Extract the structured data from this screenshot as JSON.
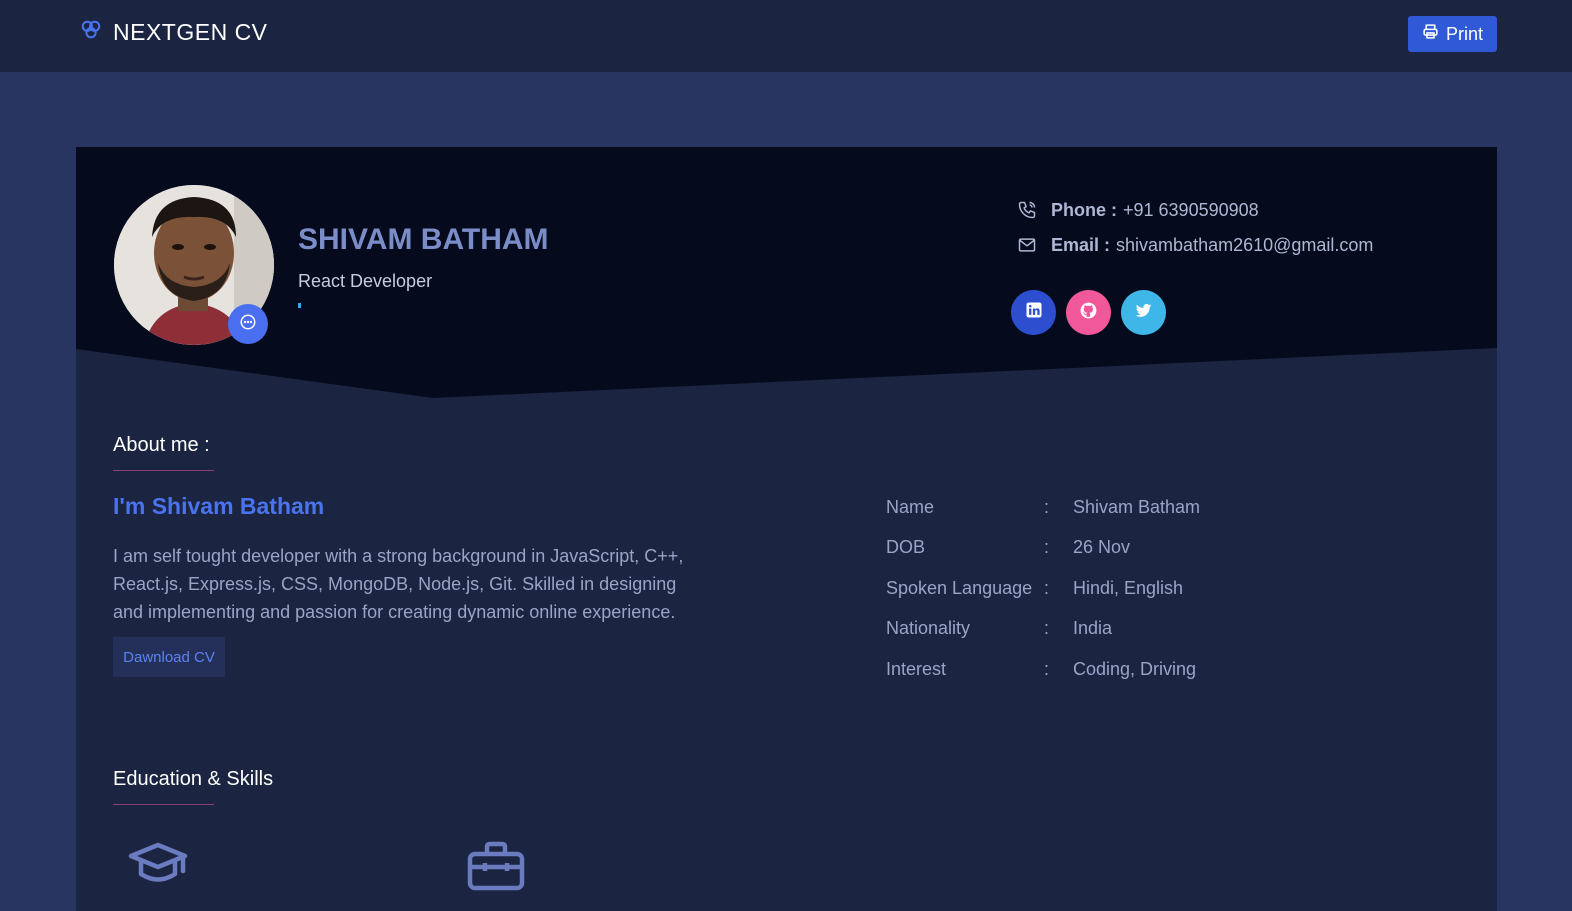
{
  "header": {
    "brand": "NEXTGEN CV",
    "print_label": "Print"
  },
  "profile": {
    "name": "SHIVAM BATHAM",
    "role": "React Developer"
  },
  "contact": {
    "phone_label": "Phone :",
    "phone": "+91 6390590908",
    "email_label": "Email :",
    "email": "shivambatham2610@gmail.com"
  },
  "social": [
    "linkedin-icon",
    "github-icon",
    "twitter-icon"
  ],
  "about": {
    "title": "About me :",
    "intro": "I'm Shivam Batham",
    "bio": "I am self tought developer with a strong background in JavaScript, C++, React.js, Express.js, CSS, MongoDB, Node.js, Git. Skilled in designing and implementing and passion for creating dynamic online experience.",
    "download_label": "Dawnload CV"
  },
  "info": [
    {
      "key": "Name",
      "sep": ":",
      "value": "Shivam Batham"
    },
    {
      "key": "DOB",
      "sep": ":",
      "value": "26 Nov"
    },
    {
      "key": "Spoken Language",
      "sep": ":",
      "value": "Hindi, English"
    },
    {
      "key": "Nationality",
      "sep": ":",
      "value": "India"
    },
    {
      "key": "Interest",
      "sep": ":",
      "value": "Coding, Driving"
    }
  ],
  "education": {
    "title": "Education & Skills"
  },
  "colors": {
    "page_bg": "#283560",
    "topbar_bg": "#1b2440",
    "hero_bg": "#050a1c",
    "accent": "#4a73ef",
    "print_button": "#2f59d6",
    "linkedin": "#2c4ecf",
    "github": "#f0589a",
    "twitter": "#3fb6e8"
  }
}
